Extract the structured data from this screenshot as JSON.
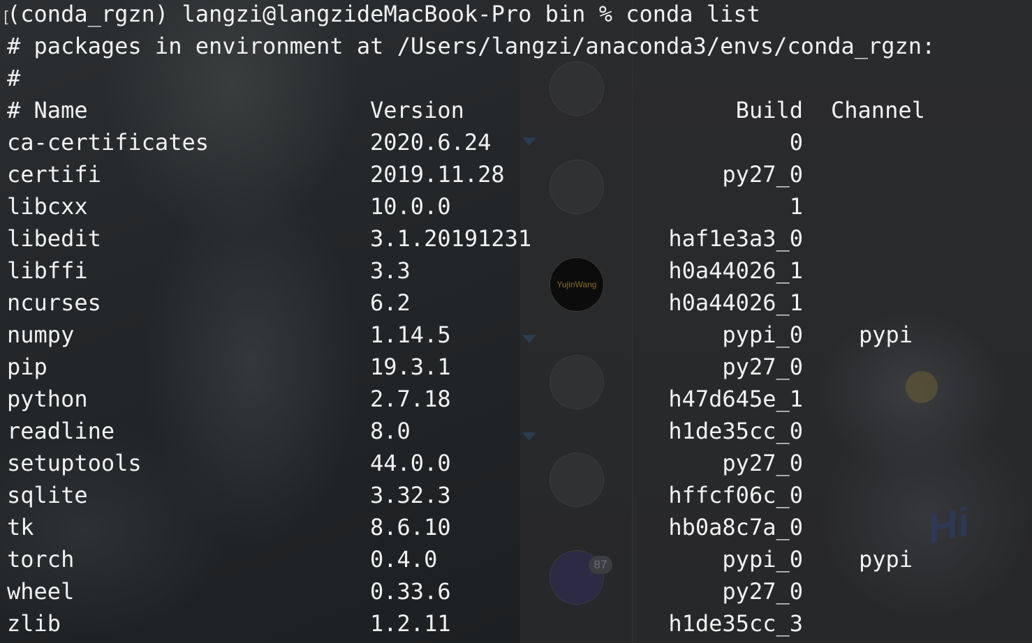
{
  "terminal": {
    "prompt_line": "(conda_rgzn) langzi@langzideMacBook-Pro bin % conda list",
    "env_line": "# packages in environment at /Users/langzi/anaconda3/envs/conda_rgzn:",
    "hash_line": "#",
    "headers": {
      "name": "# Name",
      "version": "Version",
      "build": "Build",
      "channel": "Channel"
    },
    "packages": [
      {
        "name": "ca-certificates",
        "version": "2020.6.24",
        "build": "0",
        "channel": ""
      },
      {
        "name": "certifi",
        "version": "2019.11.28",
        "build": "py27_0",
        "channel": ""
      },
      {
        "name": "libcxx",
        "version": "10.0.0",
        "build": "1",
        "channel": ""
      },
      {
        "name": "libedit",
        "version": "3.1.20191231",
        "build": "haf1e3a3_0",
        "channel": ""
      },
      {
        "name": "libffi",
        "version": "3.3",
        "build": "h0a44026_1",
        "channel": ""
      },
      {
        "name": "ncurses",
        "version": "6.2",
        "build": "h0a44026_1",
        "channel": ""
      },
      {
        "name": "numpy",
        "version": "1.14.5",
        "build": "pypi_0",
        "channel": "pypi"
      },
      {
        "name": "pip",
        "version": "19.3.1",
        "build": "py27_0",
        "channel": ""
      },
      {
        "name": "python",
        "version": "2.7.18",
        "build": "h47d645e_1",
        "channel": ""
      },
      {
        "name": "readline",
        "version": "8.0",
        "build": "h1de35cc_0",
        "channel": ""
      },
      {
        "name": "setuptools",
        "version": "44.0.0",
        "build": "py27_0",
        "channel": ""
      },
      {
        "name": "sqlite",
        "version": "3.32.3",
        "build": "hffcf06c_0",
        "channel": ""
      },
      {
        "name": "tk",
        "version": "8.6.10",
        "build": "hb0a8c7a_0",
        "channel": ""
      },
      {
        "name": "torch",
        "version": "0.4.0",
        "build": "pypi_0",
        "channel": "pypi"
      },
      {
        "name": "wheel",
        "version": "0.33.6",
        "build": "py27_0",
        "channel": ""
      },
      {
        "name": "zlib",
        "version": "1.2.11",
        "build": "h1de35cc_3",
        "channel": ""
      }
    ]
  },
  "background": {
    "avatar_label": "YujinWang",
    "badge_count": "87",
    "deco_text": "Hi"
  }
}
